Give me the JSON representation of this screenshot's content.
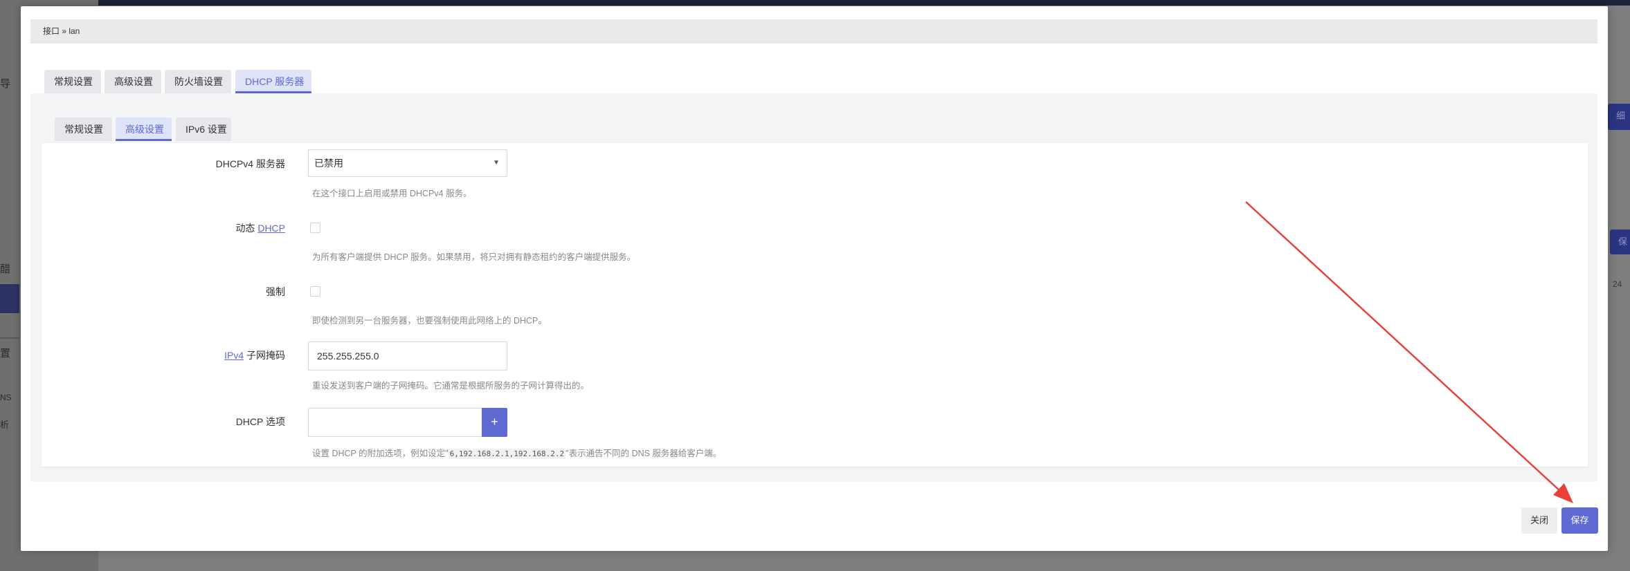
{
  "background": {
    "sidebar_fragments": [
      "导",
      "醋",
      "置",
      "NS",
      "析"
    ],
    "right_fragments": [
      "细",
      "保",
      "24"
    ]
  },
  "breadcrumb": "接口 » lan",
  "main_tabs": [
    {
      "label": "常规设置",
      "active": false
    },
    {
      "label": "高级设置",
      "active": false
    },
    {
      "label": "防火墙设置",
      "active": false
    },
    {
      "label": "DHCP 服务器",
      "active": true
    }
  ],
  "sub_tabs": [
    {
      "label": "常规设置",
      "active": false
    },
    {
      "label": "高级设置",
      "active": true
    },
    {
      "label": "IPv6 设置",
      "active": false
    }
  ],
  "form": {
    "dhcpv4": {
      "label": "DHCPv4 服务器",
      "value": "已禁用",
      "help": "在这个接口上启用或禁用 DHCPv4 服务。"
    },
    "dynamic_dhcp": {
      "label_prefix": "动态 ",
      "label_link": "DHCP",
      "checked": false,
      "help": "为所有客户端提供 DHCP 服务。如果禁用，将只对拥有静态租约的客户端提供服务。"
    },
    "force": {
      "label": "强制",
      "checked": false,
      "help": "即使检测到另一台服务器，也要强制使用此网络上的 DHCP。"
    },
    "netmask": {
      "label_link": "IPv4",
      "label_suffix": " 子网掩码",
      "value": "255.255.255.0",
      "help": "重设发送到客户端的子网掩码。它通常是根据所服务的子网计算得出的。"
    },
    "dhcp_options": {
      "label": "DHCP 选项",
      "value": "",
      "add_label": "+",
      "help_before": "设置 DHCP 的附加选项，例如设定\"",
      "help_code": "6,192.168.2.1,192.168.2.2",
      "help_after": "\"表示通告不同的 DNS 服务器给客户端。"
    }
  },
  "footer": {
    "close_label": "关闭",
    "save_label": "保存"
  },
  "colors": {
    "accent": "#5e6ad2",
    "arrow": "#e8413a",
    "overlay": "#7d7d7d"
  }
}
